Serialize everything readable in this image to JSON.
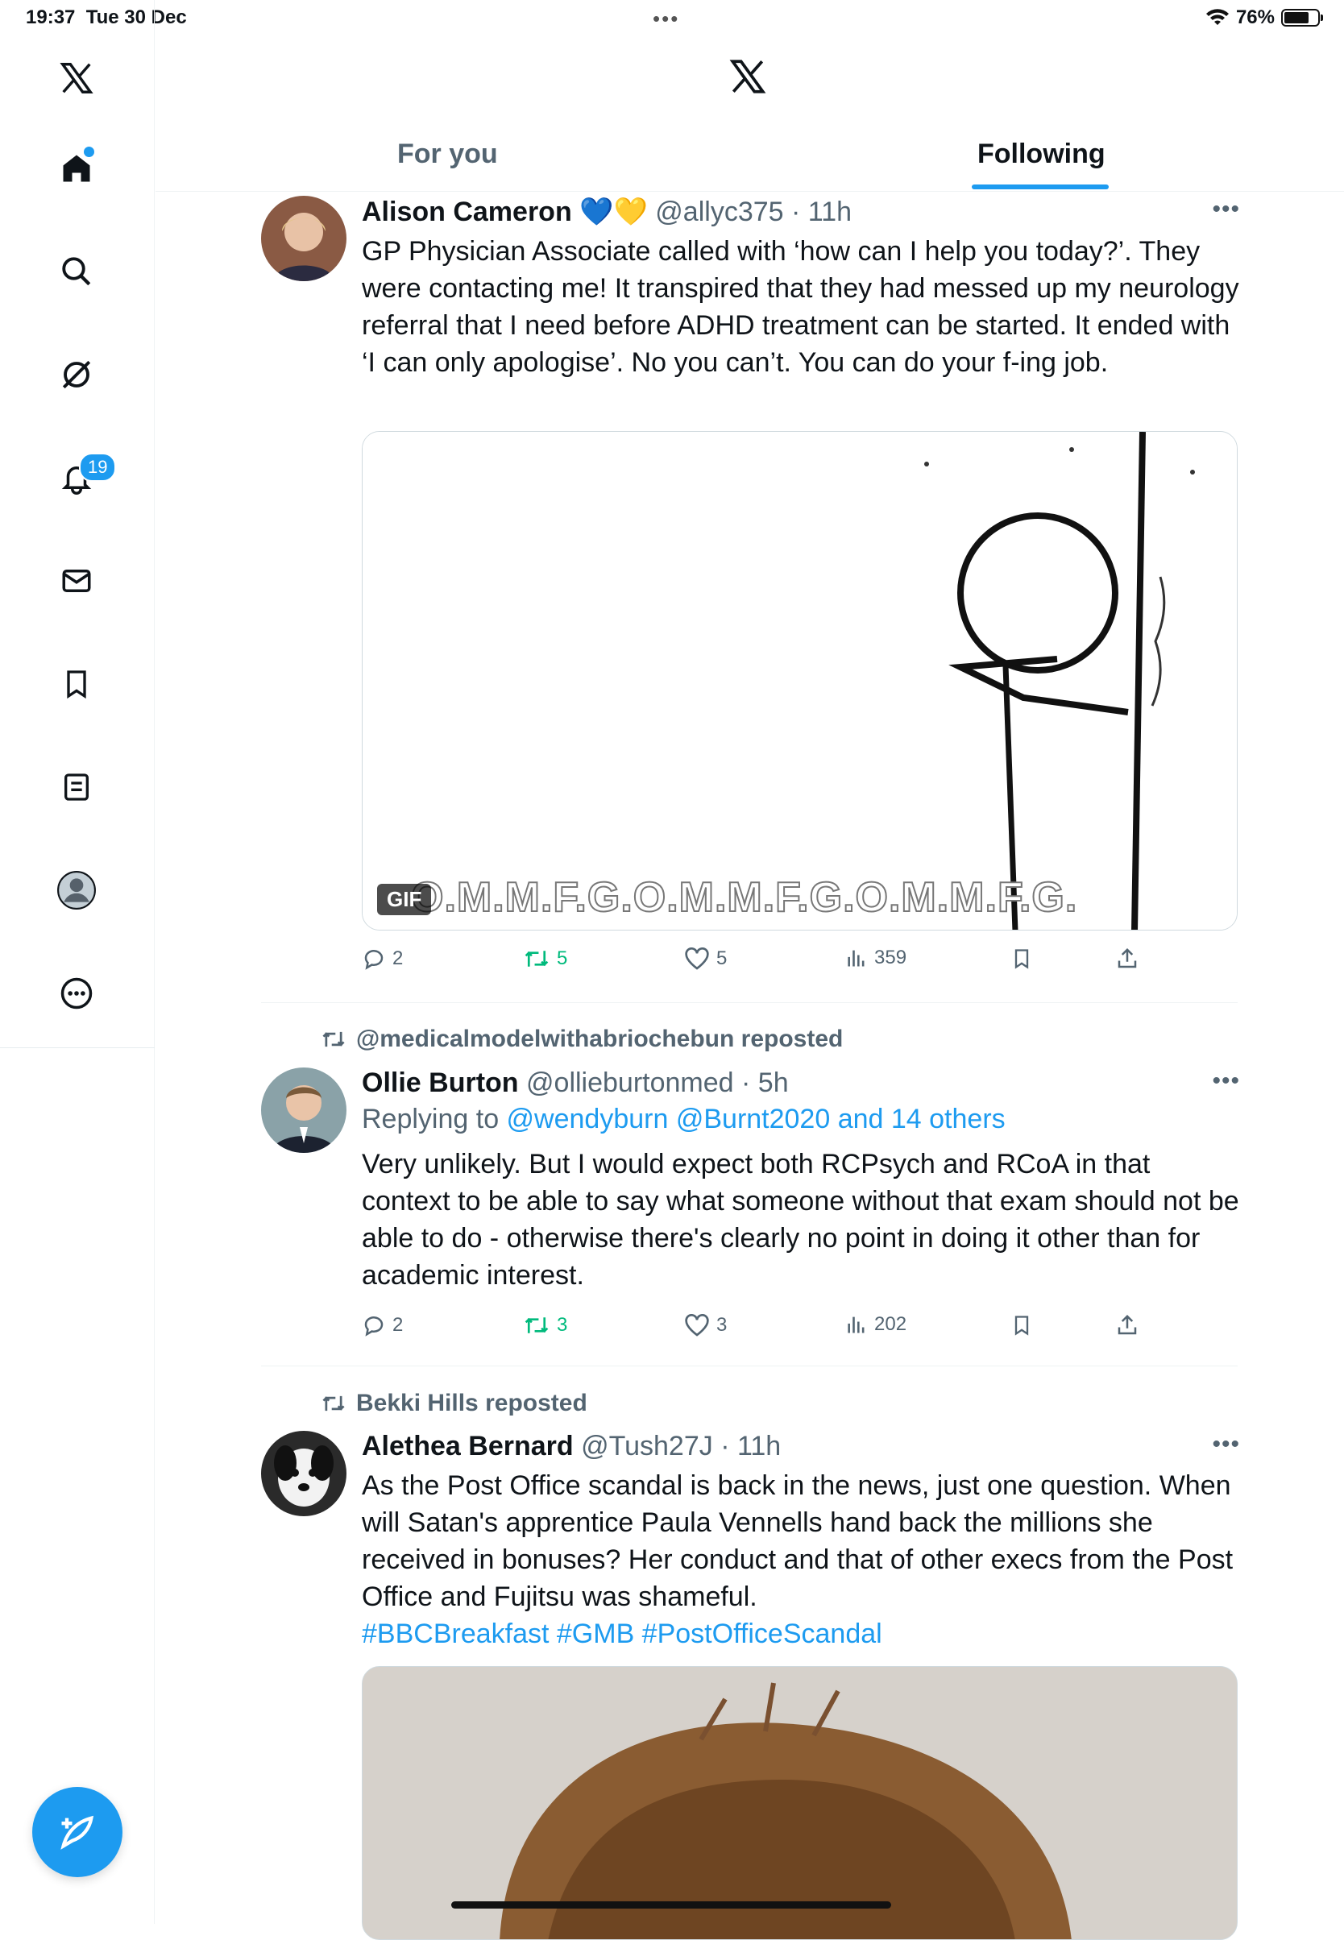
{
  "status": {
    "time": "19:37",
    "date": "Tue 30 Dec",
    "battery": "76%",
    "battery_level": 0.76
  },
  "sidebar": {
    "items": [
      {
        "label": "X",
        "icon": "x-logo-icon"
      },
      {
        "label": "Home",
        "icon": "home-icon"
      },
      {
        "label": "Search",
        "icon": "search-icon"
      },
      {
        "label": "Grok",
        "icon": "grok-icon"
      },
      {
        "label": "Notifications",
        "icon": "bell-icon",
        "badge": "19"
      },
      {
        "label": "Messages",
        "icon": "mail-icon"
      },
      {
        "label": "Bookmarks",
        "icon": "bookmark-icon"
      },
      {
        "label": "Lists",
        "icon": "list-icon"
      },
      {
        "label": "Profile",
        "icon": "profile-icon"
      },
      {
        "label": "More",
        "icon": "more-icon"
      }
    ],
    "compose": "compose-icon"
  },
  "header": {
    "tabs": [
      {
        "label": "For you"
      },
      {
        "label": "Following",
        "active": true
      }
    ]
  },
  "posts": [
    {
      "name": "Alison Cameron",
      "emojis": "💙💛",
      "handle": "@allyc375",
      "time": "11h",
      "text": "GP Physician Associate called with ‘how can I help you today?’. They were contacting me! It transpired that they had messed up my neurology referral that I need before ADHD treatment can be started. It ended with ‘I can only apologise’. No you can’t. You can do your f-ing job.",
      "media": {
        "type": "GIF",
        "badge": "GIF",
        "caption": "O.M.M.F.G.O.M.M.F.G.O.M.M.F.G."
      },
      "stats": {
        "replies": "2",
        "reposts": "5",
        "likes": "5",
        "views": "359"
      }
    },
    {
      "reposted_by": "@medicalmodelwithabriochebun reposted",
      "name": "Ollie Burton",
      "handle": "@ollieburtonmed",
      "time": "5h",
      "replying_prefix": "Replying to ",
      "replying_to": "@wendyburn @Burnt2020 and 14 others",
      "text": "Very unlikely. But I would expect both RCPsych and RCoA in that context to be able to say what someone without that exam should not be able to do - otherwise there's clearly no point in doing it other than for academic interest.",
      "stats": {
        "replies": "2",
        "reposts": "3",
        "likes": "3",
        "views": "202"
      }
    },
    {
      "reposted_by": "Bekki Hills reposted",
      "name": "Alethea Bernard",
      "handle": "@Tush27J",
      "time": "11h",
      "text": "As the Post Office scandal is back in the news, just one question. When will Satan's apprentice Paula Vennells hand back the millions she received in bonuses? Her conduct and that of other execs from the Post Office and Fujitsu was shameful.",
      "hashtags": "#BBCBreakfast #GMB #PostOfficeScandal"
    }
  ],
  "colors": {
    "accent": "#1d9bf0",
    "repost": "#00ba7c",
    "secondary": "#536471"
  }
}
